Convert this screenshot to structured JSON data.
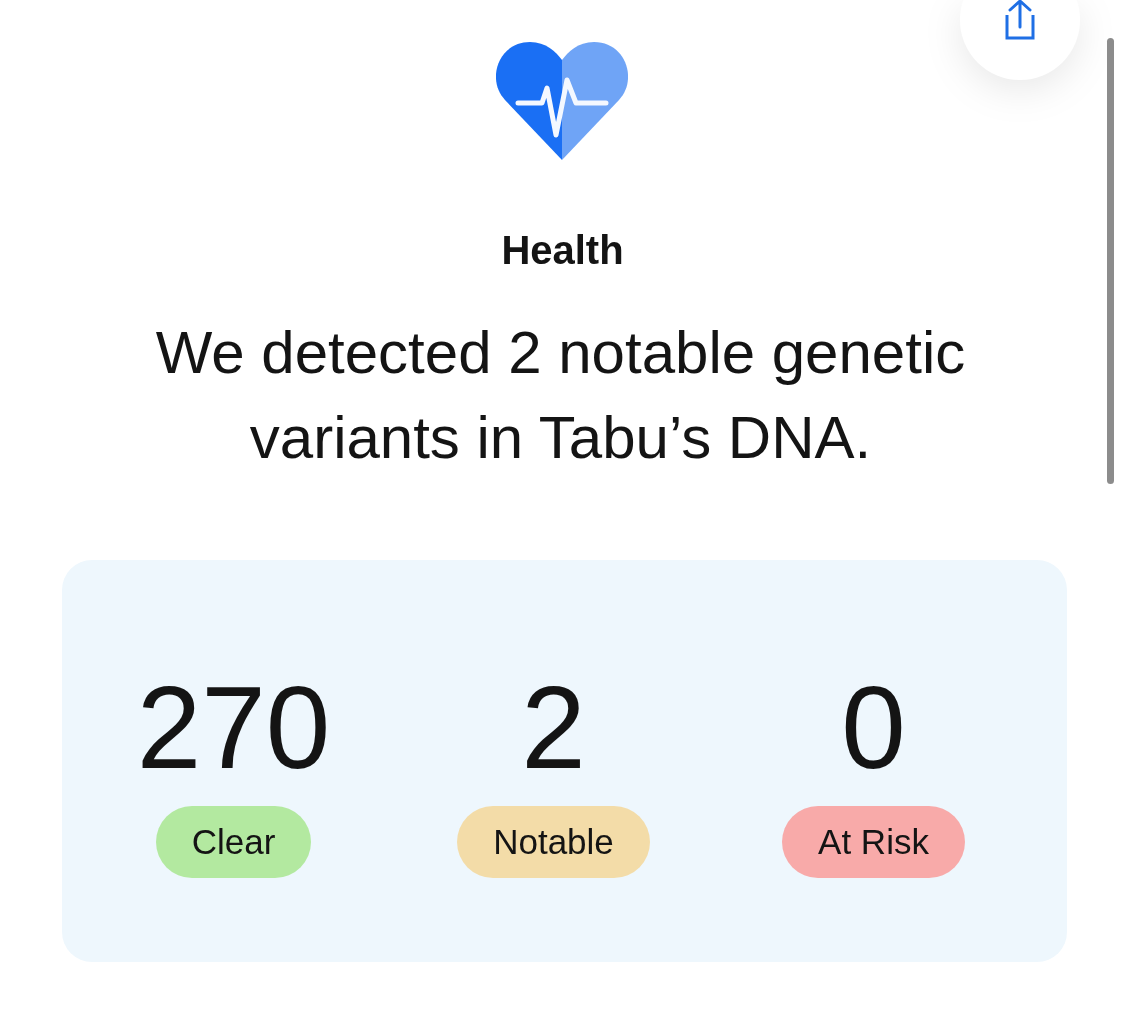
{
  "header": {
    "category": "Health",
    "headline": "We detected 2 notable genetic variants in Tabu’s DNA."
  },
  "summary": {
    "stats": [
      {
        "count": "270",
        "label": "Clear",
        "color": "#b3e9a0"
      },
      {
        "count": "2",
        "label": "Notable",
        "color": "#f3dca8"
      },
      {
        "count": "0",
        "label": "At Risk",
        "color": "#f8aaa9"
      }
    ]
  }
}
